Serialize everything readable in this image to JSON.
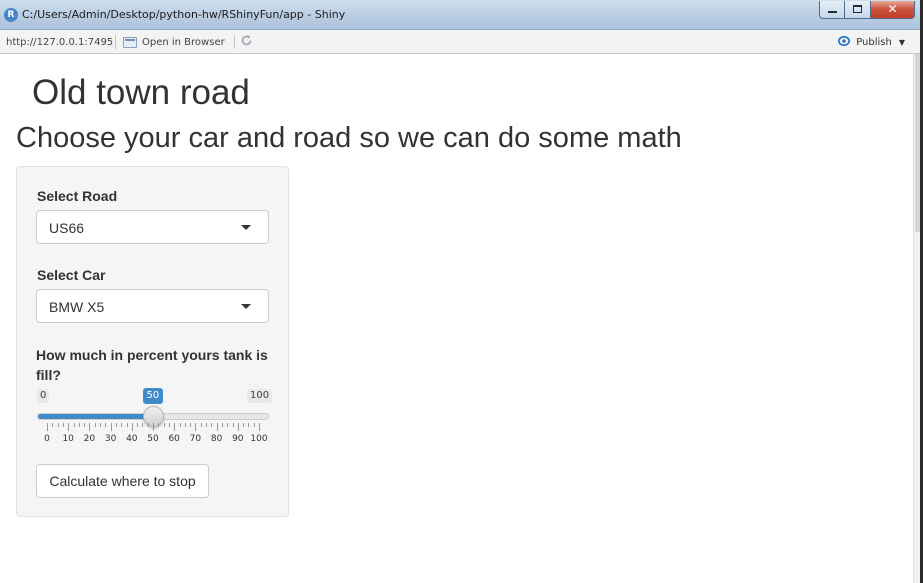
{
  "window": {
    "title": "C:/Users/Admin/Desktop/python-hw/RShinyFun/app - Shiny",
    "app_icon": "R",
    "close_glyph": "✕"
  },
  "toolbar": {
    "url": "http://127.0.0.1:7495",
    "open_in_browser": "Open in Browser",
    "publish": "Publish"
  },
  "page": {
    "title": "Old town road",
    "subtitle": "Choose your car and road so we can do some math"
  },
  "inputs": {
    "road": {
      "label": "Select Road",
      "value": "US66"
    },
    "car": {
      "label": "Select Car",
      "value": "BMW X5"
    },
    "tank": {
      "label": "How much in percent yours tank is fill?",
      "min": 0,
      "max": 100,
      "value": 50,
      "tick_labels": [
        "0",
        "10",
        "20",
        "30",
        "40",
        "50",
        "60",
        "70",
        "80",
        "90",
        "100"
      ]
    }
  },
  "action": {
    "calculate_label": "Calculate where to stop"
  },
  "colors": {
    "accent": "#428bca",
    "panel": "#f5f5f5",
    "text": "#333333"
  },
  "icons": {
    "app": "r-logo-icon",
    "browser": "browser-window-icon",
    "refresh": "refresh-icon",
    "publish": "publish-icon",
    "select_caret": "caret-down-icon"
  }
}
